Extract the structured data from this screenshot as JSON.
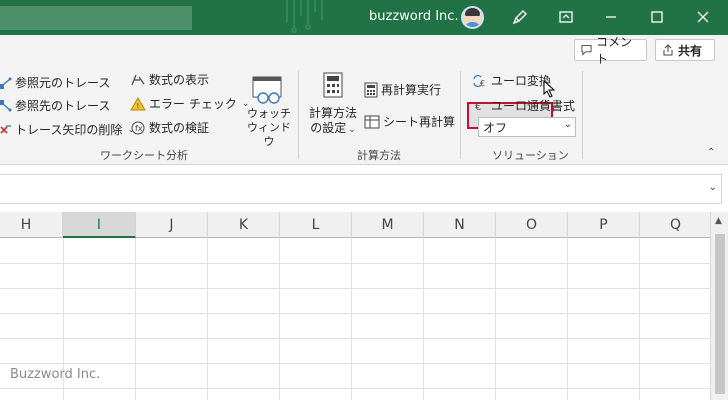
{
  "titlebar": {
    "app_title": "buzzword Inc.",
    "color": "#217346"
  },
  "ribbon": {
    "comment_label": "コメント",
    "share_label": "共有",
    "groups": {
      "worksheet_analysis": {
        "label": "ワークシート分析",
        "trace_precedents": "参照元のトレース",
        "trace_dependents": "参照先のトレース",
        "remove_arrows": "トレース矢印の削除",
        "show_formulas": "数式の表示",
        "error_check": "エラー チェック",
        "evaluate_formula": "数式の検証",
        "watch_window_line1": "ウォッチ",
        "watch_window_line2": "ウィンドウ"
      },
      "calculation": {
        "label": "計算方法",
        "calc_options_line1": "計算方法",
        "calc_options_line2": "の設定",
        "calculate_now": "再計算実行",
        "calculate_sheet": "シート再計算"
      },
      "solutions": {
        "label": "ソリューション",
        "euro_conversion": "ユーロ変換",
        "euro_formatting": "ユーロ通貨書式",
        "format_value": "オフ"
      }
    }
  },
  "grid": {
    "columns": [
      "H",
      "I",
      "J",
      "K",
      "L",
      "M",
      "N",
      "O",
      "P",
      "Q"
    ],
    "active_column": "I"
  },
  "watermark": "Buzzword Inc."
}
